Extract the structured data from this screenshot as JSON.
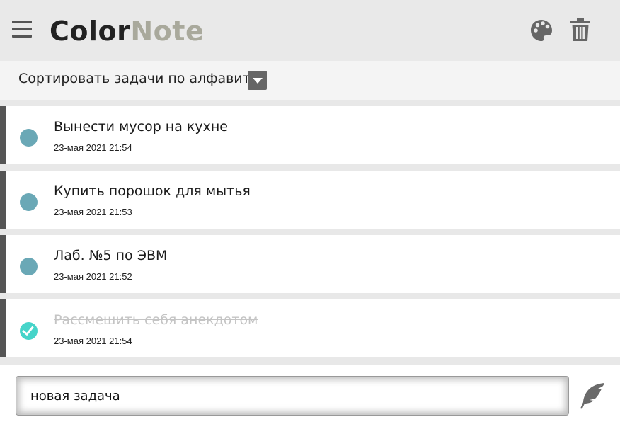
{
  "header": {
    "logo_part1": "Color",
    "logo_part2": "Note",
    "icons": [
      "menu-icon",
      "palette-icon",
      "trash-icon"
    ]
  },
  "sort": {
    "label": "Сортировать задачи по алфавиту",
    "dropdown_icon": "chevron-down-icon"
  },
  "tasks": [
    {
      "title": "Вынести мусор на кухне",
      "date": "23-мая 2021 21:54",
      "done": false
    },
    {
      "title": "Купить порошок для мытья",
      "date": "23-мая 2021 21:53",
      "done": false
    },
    {
      "title": "Лаб. №5 по ЭВМ",
      "date": "23-мая 2021 21:52",
      "done": false
    },
    {
      "title": "Рассмешить себя анекдотом",
      "date": "23-мая 2021 21:54",
      "done": true
    }
  ],
  "input": {
    "value": "новая задача"
  },
  "colors": {
    "accent_dot": "#6aa8b6",
    "done_dot": "#46d4c9",
    "logo_dark": "#222222",
    "logo_light": "#a9a99c"
  }
}
